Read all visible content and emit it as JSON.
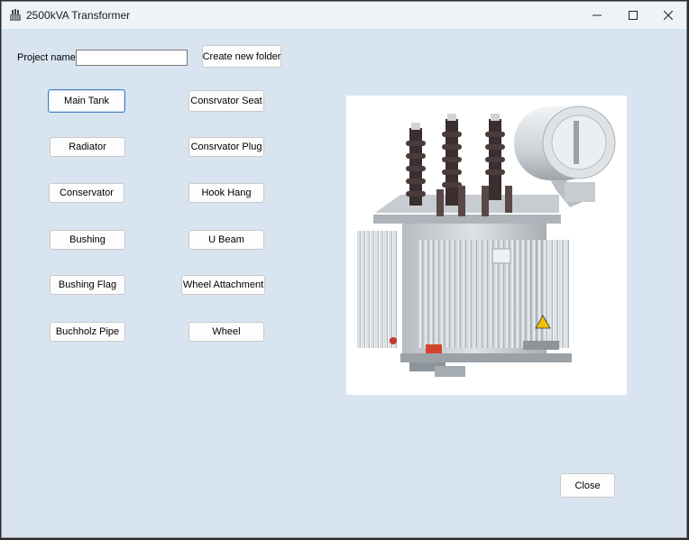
{
  "window": {
    "title": "2500kVA Transformer",
    "app_icon": "transformer-icon",
    "controls": {
      "minimize": "minimize-icon",
      "maximize": "maximize-icon",
      "close": "close-icon"
    }
  },
  "project": {
    "label": "Project name",
    "value": "",
    "create_folder_label": "Create new folder"
  },
  "parts_left": [
    {
      "label": "Main Tank",
      "focused": true
    },
    {
      "label": "Radiator"
    },
    {
      "label": "Conservator"
    },
    {
      "label": "Bushing"
    },
    {
      "label": "Bushing Flag"
    },
    {
      "label": "Buchholz Pipe"
    }
  ],
  "parts_right": [
    {
      "label": "Consrvator Seat"
    },
    {
      "label": "Consrvator Plug"
    },
    {
      "label": "Hook Hang"
    },
    {
      "label": "U Beam"
    },
    {
      "label": "Wheel Attachment"
    },
    {
      "label": "Wheel"
    }
  ],
  "close_label": "Close",
  "image": {
    "subject": "oil-immersed power transformer"
  }
}
